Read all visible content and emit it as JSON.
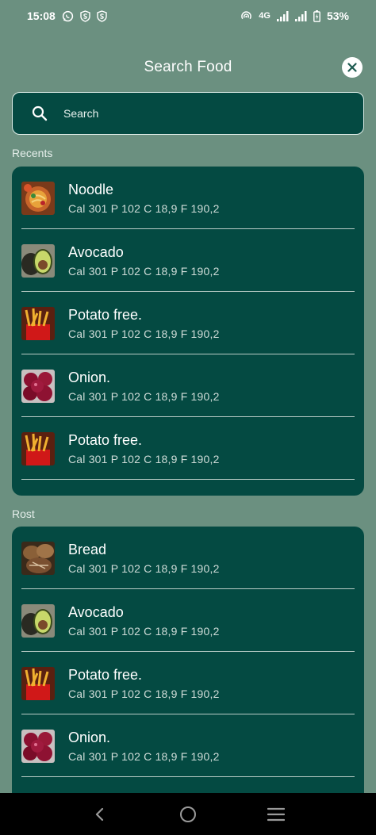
{
  "status_bar": {
    "time": "15:08",
    "network": "4G",
    "battery": "53%"
  },
  "header": {
    "title": "Search Food"
  },
  "search": {
    "placeholder": "Search",
    "value": ""
  },
  "sections": [
    {
      "label": "Recents",
      "items": [
        {
          "name": "Noodle",
          "macros": "Cal 301 P 102 C 18,9 F 190,2",
          "image": "noodle"
        },
        {
          "name": "Avocado",
          "macros": "Cal 301 P 102 C 18,9 F 190,2",
          "image": "avocado"
        },
        {
          "name": "Potato free.",
          "macros": "Cal 301 P 102 C 18,9 F 190,2",
          "image": "fries"
        },
        {
          "name": "Onion.",
          "macros": "Cal 301 P 102 C 18,9 F 190,2",
          "image": "onion"
        },
        {
          "name": "Potato free.",
          "macros": "Cal 301 P 102 C 18,9 F 190,2",
          "image": "fries"
        }
      ]
    },
    {
      "label": "Rost",
      "items": [
        {
          "name": "Bread",
          "macros": "Cal 301 P 102 C 18,9 F 190,2",
          "image": "bread"
        },
        {
          "name": "Avocado",
          "macros": "Cal 301 P 102 C 18,9 F 190,2",
          "image": "avocado"
        },
        {
          "name": "Potato free.",
          "macros": "Cal 301 P 102 C 18,9 F 190,2",
          "image": "fries"
        },
        {
          "name": "Onion.",
          "macros": "Cal 301 P 102 C 18,9 F 190,2",
          "image": "onion"
        }
      ]
    }
  ],
  "colors": {
    "background": "#6b9080",
    "card": "#044a42",
    "divider": "#b9ccc6"
  }
}
